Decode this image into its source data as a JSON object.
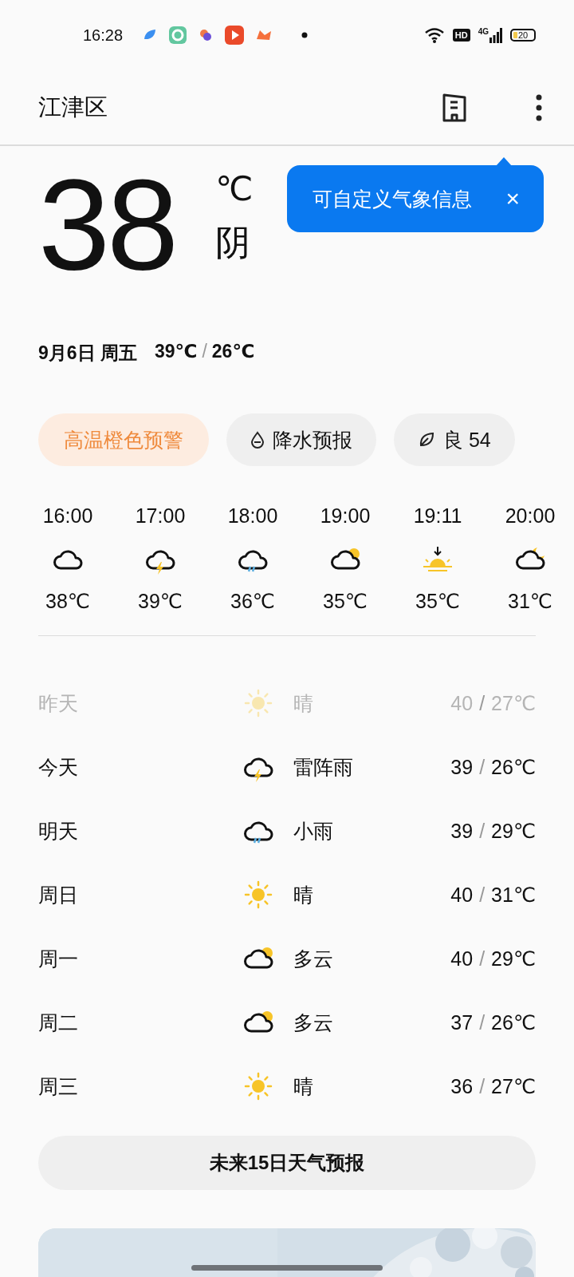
{
  "status_bar": {
    "time": "16:28",
    "hd": "HD",
    "network": "4G",
    "battery": "20"
  },
  "header": {
    "location": "江津区"
  },
  "tooltip": {
    "text": "可自定义气象信息",
    "close": "×"
  },
  "current": {
    "temperature": "38",
    "unit": "℃",
    "condition": "阴",
    "date": "9月6日 周五",
    "high": "39℃",
    "separator": "/",
    "low": "26℃"
  },
  "chips": [
    {
      "kind": "warning",
      "label": "高温橙色预警"
    },
    {
      "kind": "precip",
      "label": "降水预报"
    },
    {
      "kind": "air",
      "label": "良 54"
    }
  ],
  "hourly": [
    {
      "time": "16:00",
      "kind": "cloudy",
      "temp": "38℃"
    },
    {
      "time": "17:00",
      "kind": "thunder",
      "temp": "39℃"
    },
    {
      "time": "18:00",
      "kind": "rain",
      "temp": "36℃"
    },
    {
      "time": "19:00",
      "kind": "partly-day",
      "temp": "35℃"
    },
    {
      "time": "19:11",
      "kind": "sunset",
      "temp": "35℃"
    },
    {
      "time": "20:00",
      "kind": "partly-night",
      "temp": "31℃"
    }
  ],
  "daily": [
    {
      "day": "昨天",
      "kind": "sunny",
      "condition": "晴",
      "high": "40",
      "separator": "/",
      "low": "27℃",
      "past": true
    },
    {
      "day": "今天",
      "kind": "thunder",
      "condition": "雷阵雨",
      "high": "39",
      "separator": "/",
      "low": "26℃",
      "past": false
    },
    {
      "day": "明天",
      "kind": "rain",
      "condition": "小雨",
      "high": "39",
      "separator": "/",
      "low": "29℃",
      "past": false
    },
    {
      "day": "周日",
      "kind": "sunny",
      "condition": "晴",
      "high": "40",
      "separator": "/",
      "low": "31℃",
      "past": false
    },
    {
      "day": "周一",
      "kind": "partly-day",
      "condition": "多云",
      "high": "40",
      "separator": "/",
      "low": "29℃",
      "past": false
    },
    {
      "day": "周二",
      "kind": "partly-day",
      "condition": "多云",
      "high": "37",
      "separator": "/",
      "low": "26℃",
      "past": false
    },
    {
      "day": "周三",
      "kind": "sunny",
      "condition": "晴",
      "high": "36",
      "separator": "/",
      "low": "27℃",
      "past": false
    }
  ],
  "forecast_button": "未来15日天气预报"
}
